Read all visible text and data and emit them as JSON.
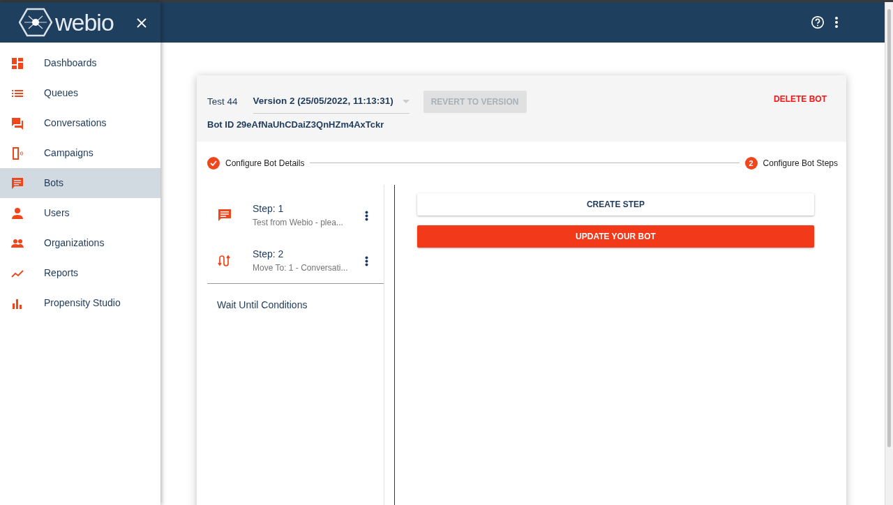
{
  "sidebar": {
    "logo": "webio",
    "items": [
      {
        "label": "Dashboards",
        "selected": false
      },
      {
        "label": "Queues",
        "selected": false
      },
      {
        "label": "Conversations",
        "selected": false
      },
      {
        "label": "Campaigns",
        "selected": false
      },
      {
        "label": "Bots",
        "selected": true
      },
      {
        "label": "Users",
        "selected": false
      },
      {
        "label": "Organizations",
        "selected": false
      },
      {
        "label": "Reports",
        "selected": false
      },
      {
        "label": "Propensity Studio",
        "selected": false
      }
    ]
  },
  "bot": {
    "name": "Test 44",
    "version": "Version 2 (25/05/2022, 11:13:31)",
    "revert_button": {
      "label": "REVERT TO VERSION",
      "disabled": true
    },
    "bot_id": "Bot ID 29eAfNaUhCDaiZ3QnHZm4AxTckr",
    "delete_button": "DELETE BOT"
  },
  "stepper": [
    {
      "label": "Configure Bot Details",
      "completed": true
    },
    {
      "label": "Configure Bot Steps",
      "completed": false,
      "number": "2"
    }
  ],
  "steps": [
    {
      "kind": "message",
      "title": "Step: 1",
      "subtitle": "Test from Webio - plea..."
    },
    {
      "kind": "move",
      "title": "Step: 2",
      "subtitle": "Move To: 1 - Conversati..."
    }
  ],
  "wait_section": "Wait Until Conditions",
  "buttons": [
    {
      "label": "CREATE STEP",
      "kind": "outline"
    },
    {
      "label": "UPDATE YOUR BOT",
      "kind": "primary"
    }
  ]
}
